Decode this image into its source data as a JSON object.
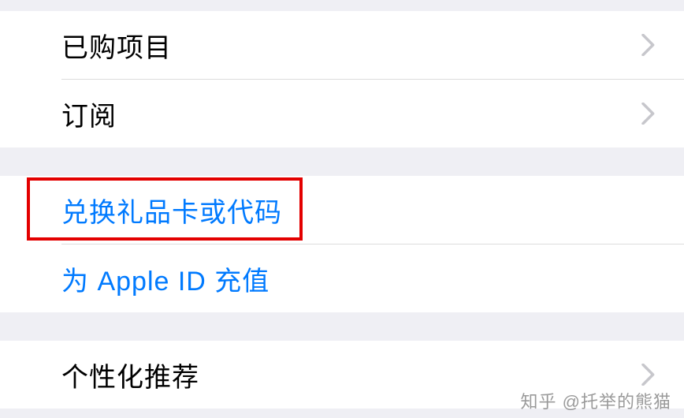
{
  "sections": {
    "group1": {
      "purchased": "已购项目",
      "subscriptions": "订阅"
    },
    "group2": {
      "redeem": "兑换礼品卡或代码",
      "add_funds": "为 Apple ID 充值"
    },
    "group3": {
      "personalized": "个性化推荐"
    }
  },
  "watermark": "知乎 @托举的熊猫"
}
